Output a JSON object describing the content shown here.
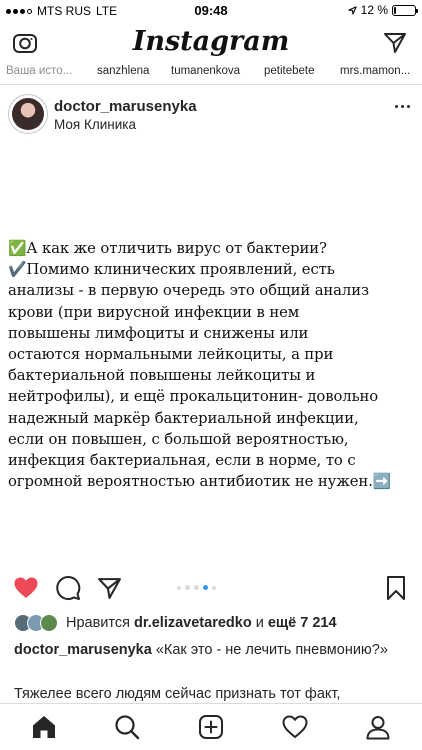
{
  "status_bar": {
    "carrier": "MTS RUS",
    "network": "LTE",
    "time": "09:48",
    "battery": "12 %",
    "battery_level": 0.12
  },
  "app": {
    "title": "Instagram"
  },
  "stories": {
    "items": [
      "Ваша исто...",
      "sanzhlena",
      "tumanenkova",
      "petitebete",
      "mrs.mamon..."
    ]
  },
  "post": {
    "username": "doctor_marusenyka",
    "location": "Моя Клиника",
    "text_lines": [
      "✅А как же отличить вирус от бактерии?",
      "✔️Помимо клинических проявлений, есть",
      "анализы - в первую очередь это общий анализ",
      "крови (при вирусной инфекции в нем",
      "повышены лимфоциты и снижены или",
      "остаются нормальными лейкоциты, а при",
      "бактериальной повышены лейкоциты и",
      "нейтрофилы), и ещё прокальцитонин- довольно",
      "надежный маркёр бактериальной инфекции,",
      "если он повышен, с большой вероятностью,",
      "инфекция бактериальная, если в норме, то с",
      "огромной вероятностью антибиотик не нужен.➡️"
    ],
    "carousel": {
      "count": 5,
      "active_index": 3
    },
    "likes": {
      "prefix": "Нравится",
      "user": "dr.elizavetaredko",
      "middle": "и",
      "count_text": "ещё 7 214"
    },
    "caption": {
      "username": "doctor_marusenyka",
      "text": "«Как это - не лечить пневмонию?»",
      "next_line": "Тяжелее всего людям сейчас признать тот факт,"
    }
  },
  "colors": {
    "heart_red": "#ed4956",
    "carousel_active": "#3897f0",
    "separator": "#dbdbdb"
  },
  "icons": [
    "camera-icon",
    "direct-send-icon",
    "more-icon",
    "heart-icon",
    "comment-icon",
    "share-icon",
    "bookmark-icon",
    "home-icon",
    "search-icon",
    "add-post-icon",
    "activity-heart-icon",
    "profile-icon"
  ]
}
